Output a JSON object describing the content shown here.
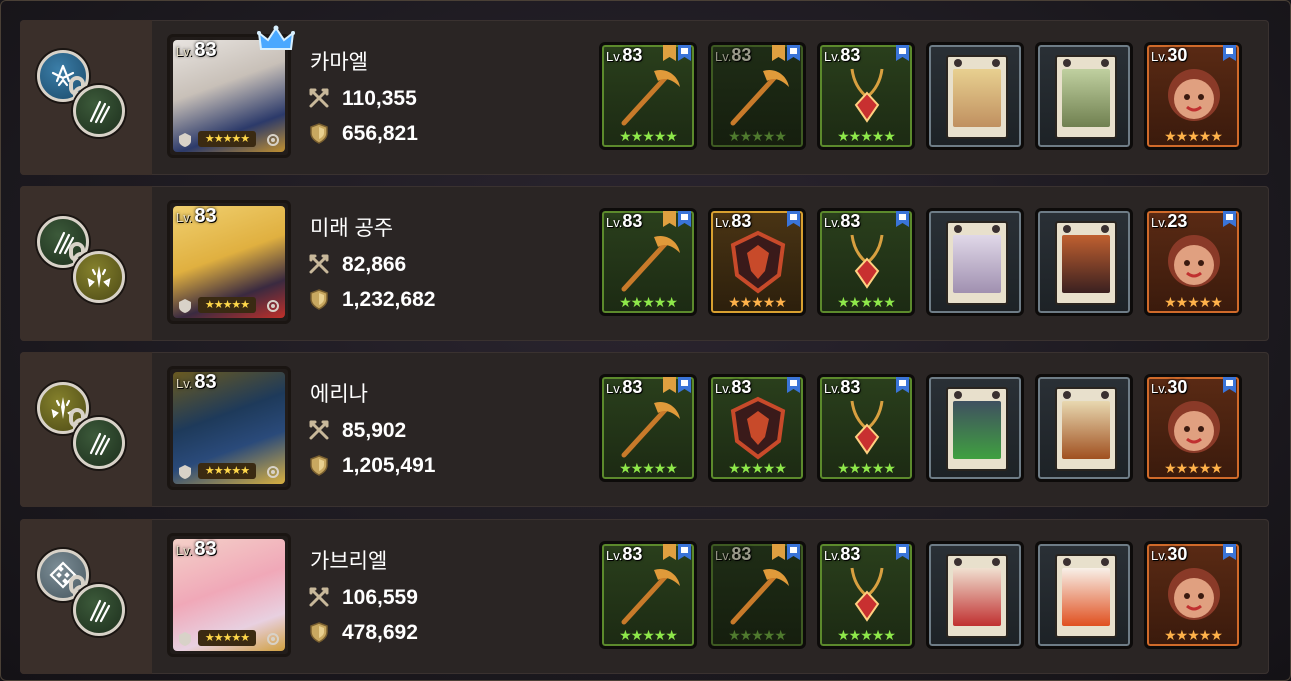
{
  "heroes": [
    {
      "level_prefix": "Lv.",
      "level": "83",
      "name": "카마엘",
      "attack": "110,355",
      "defense": "656,821",
      "stars": "★★★★★",
      "crown": true,
      "element_top": "wing-icon",
      "element_bottom": "claw-icon",
      "element_top_color": "blue",
      "element_bottom_color": "green",
      "gear": [
        {
          "kind": "weapon",
          "frame": "green",
          "level": "83",
          "stars": "★★★★★",
          "flags": [
            "blue",
            "orange"
          ]
        },
        {
          "kind": "weapon",
          "frame": "greendim",
          "level": "83",
          "stars": "★★★★★",
          "flags": [
            "blue",
            "orange"
          ]
        },
        {
          "kind": "accessory",
          "frame": "green",
          "level": "83",
          "stars": "★★★★★",
          "flags": [
            "blue"
          ]
        },
        {
          "kind": "card",
          "frame": "card",
          "level": "",
          "stars": "",
          "flags": []
        },
        {
          "kind": "card",
          "frame": "card",
          "level": "",
          "stars": "",
          "flags": []
        },
        {
          "kind": "merch",
          "frame": "orange",
          "level": "30",
          "stars": "★★★★★",
          "flags": [
            "blue"
          ]
        }
      ]
    },
    {
      "level_prefix": "Lv.",
      "level": "83",
      "name": "미래 공주",
      "attack": "82,866",
      "defense": "1,232,682",
      "stars": "★★★★★",
      "crown": false,
      "element_top": "claw-icon",
      "element_bottom": "star-burst-icon",
      "element_top_color": "green",
      "element_bottom_color": "olive",
      "gear": [
        {
          "kind": "weapon",
          "frame": "green",
          "level": "83",
          "stars": "★★★★★",
          "flags": [
            "blue",
            "orange"
          ]
        },
        {
          "kind": "shield",
          "frame": "gold",
          "level": "83",
          "stars": "★★★★★",
          "flags": [
            "blue"
          ]
        },
        {
          "kind": "accessory",
          "frame": "green",
          "level": "83",
          "stars": "★★★★★",
          "flags": [
            "blue"
          ]
        },
        {
          "kind": "card",
          "frame": "card",
          "level": "",
          "stars": "",
          "flags": []
        },
        {
          "kind": "card",
          "frame": "card",
          "level": "",
          "stars": "",
          "flags": []
        },
        {
          "kind": "merch",
          "frame": "orange",
          "level": "23",
          "stars": "★★★★★",
          "flags": [
            "blue"
          ]
        }
      ]
    },
    {
      "level_prefix": "Lv.",
      "level": "83",
      "name": "에리나",
      "attack": "85,902",
      "defense": "1,205,491",
      "stars": "★★★★★",
      "crown": false,
      "element_top": "star-burst-icon",
      "element_bottom": "claw-icon",
      "element_top_color": "olive",
      "element_bottom_color": "green",
      "gear": [
        {
          "kind": "weapon",
          "frame": "green",
          "level": "83",
          "stars": "★★★★★",
          "flags": [
            "blue",
            "orange"
          ]
        },
        {
          "kind": "shield",
          "frame": "green",
          "level": "83",
          "stars": "★★★★★",
          "flags": [
            "blue"
          ]
        },
        {
          "kind": "accessory",
          "frame": "green",
          "level": "83",
          "stars": "★★★★★",
          "flags": [
            "blue"
          ]
        },
        {
          "kind": "card",
          "frame": "card",
          "level": "",
          "stars": "",
          "flags": []
        },
        {
          "kind": "card",
          "frame": "card",
          "level": "",
          "stars": "",
          "flags": []
        },
        {
          "kind": "merch",
          "frame": "orange",
          "level": "30",
          "stars": "★★★★★",
          "flags": [
            "blue"
          ]
        }
      ]
    },
    {
      "level_prefix": "Lv.",
      "level": "83",
      "name": "가브리엘",
      "attack": "106,559",
      "defense": "478,692",
      "stars": "★★★★★",
      "crown": false,
      "element_top": "diamond-grid-icon",
      "element_bottom": "claw-icon",
      "element_top_color": "grey",
      "element_bottom_color": "green",
      "gear": [
        {
          "kind": "weapon",
          "frame": "green",
          "level": "83",
          "stars": "★★★★★",
          "flags": [
            "blue",
            "orange"
          ]
        },
        {
          "kind": "weapon",
          "frame": "greendim",
          "level": "83",
          "stars": "★★★★★",
          "flags": [
            "blue",
            "orange"
          ]
        },
        {
          "kind": "accessory",
          "frame": "green",
          "level": "83",
          "stars": "★★★★★",
          "flags": [
            "blue"
          ]
        },
        {
          "kind": "card",
          "frame": "card",
          "level": "",
          "stars": "",
          "flags": []
        },
        {
          "kind": "card",
          "frame": "card",
          "level": "",
          "stars": "",
          "flags": []
        },
        {
          "kind": "merch",
          "frame": "orange",
          "level": "30",
          "stars": "★★★★★",
          "flags": [
            "blue"
          ]
        }
      ]
    }
  ],
  "colors": {
    "attack_icon": "#c8b89a",
    "defense_icon": "#c8a860",
    "crown": "#4aa8ff"
  }
}
